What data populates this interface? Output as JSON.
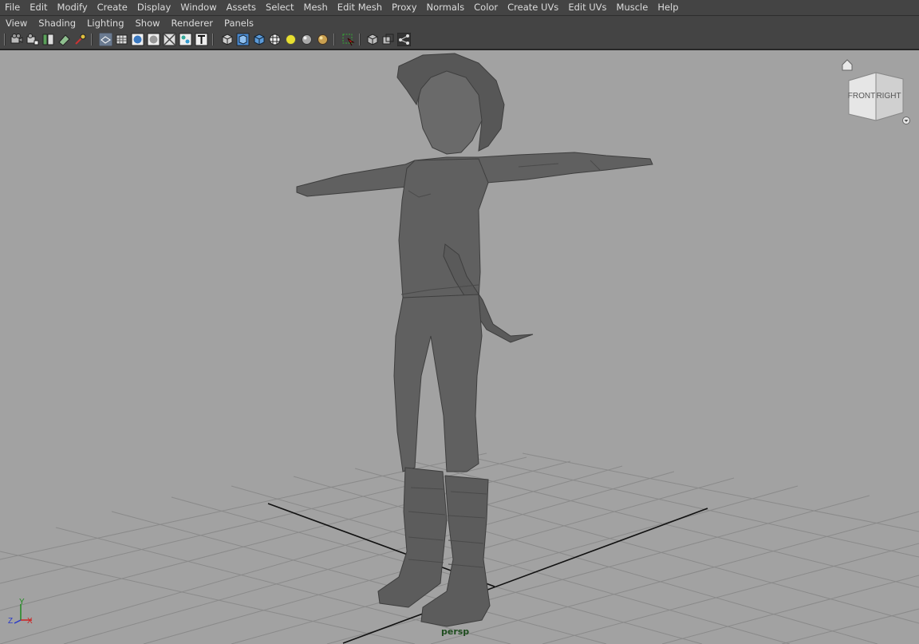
{
  "menu": {
    "items": [
      "File",
      "Edit",
      "Modify",
      "Create",
      "Display",
      "Window",
      "Assets",
      "Select",
      "Mesh",
      "Edit Mesh",
      "Proxy",
      "Normals",
      "Color",
      "Create UVs",
      "Edit UVs",
      "Muscle",
      "Help"
    ]
  },
  "panel_menu": {
    "items": [
      "View",
      "Shading",
      "Lighting",
      "Show",
      "Renderer",
      "Panels"
    ]
  },
  "toolbar": {
    "icons": [
      "camera-select-icon",
      "camera-attributes-icon",
      "bookmark-icon",
      "image-plane-icon",
      "two-d-pan-zoom-icon",
      "grease-pencil-icon",
      "wireframe-icon",
      "smooth-shade-icon",
      "default-material-icon",
      "x-ray-icon",
      "texture-icon",
      "resolution-gate-icon",
      "isolate-select-icon",
      "backface-icon",
      "lights-icon",
      "shadows-icon",
      "ambient-occlusion-icon",
      "anti-alias-icon",
      "select-highlight-icon",
      "xray-joints-icon",
      "xray-active-icon",
      "rig-icon"
    ]
  },
  "viewport": {
    "camera_label": "persp",
    "viewcube": {
      "front": "FRONT",
      "right": "RIGHT"
    },
    "axis": {
      "y": "Y",
      "z": "Z",
      "x": "X"
    },
    "colors": {
      "background": "#a2a2a2",
      "grid": "#8a8a8a",
      "grid_axis": "#111111",
      "model": "#606060",
      "model_shadow": "#484848"
    }
  }
}
